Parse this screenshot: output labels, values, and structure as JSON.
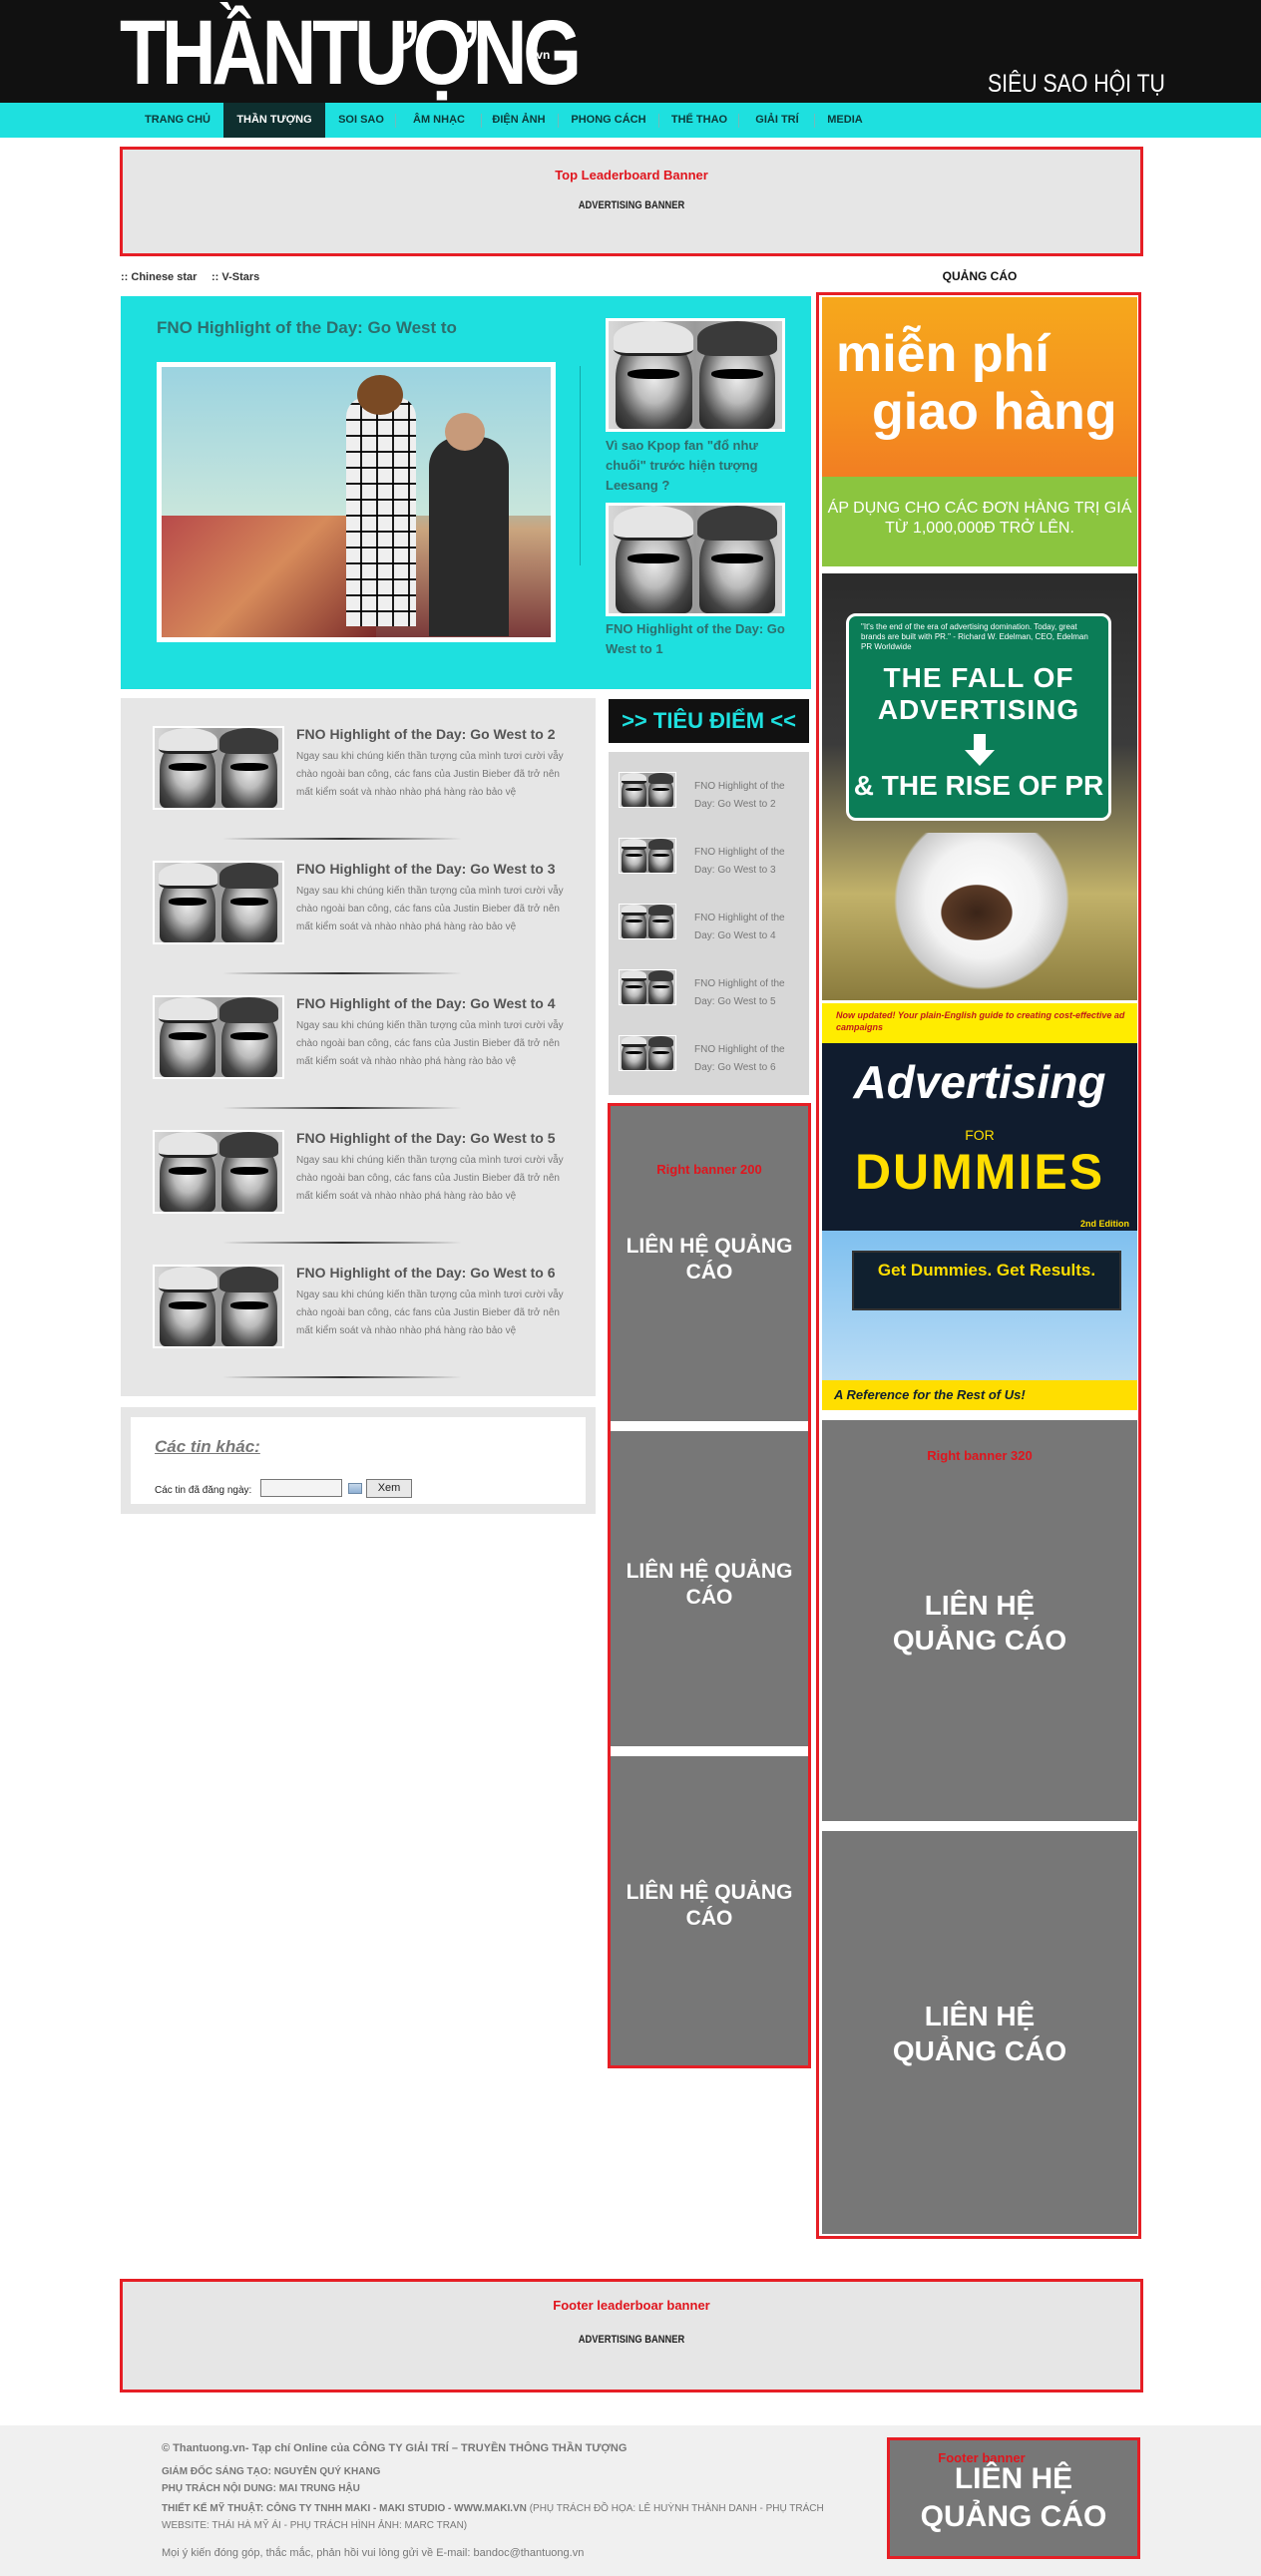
{
  "header": {
    "logo_text": "THẦNTƯỢNG",
    "logo_suffix": ".vn",
    "tagline": "SIÊU SAO HỘI TỤ"
  },
  "nav": [
    {
      "label": "TRANG CHỦ",
      "active": false
    },
    {
      "label": "THẦN TƯỢNG",
      "active": true
    },
    {
      "label": "SOI SAO",
      "active": false
    },
    {
      "label": "ÂM NHẠC",
      "active": false
    },
    {
      "label": "ĐIỆN ẢNH",
      "active": false
    },
    {
      "label": "PHONG CÁCH",
      "active": false
    },
    {
      "label": "THỂ THAO",
      "active": false
    },
    {
      "label": "GIẢI TRÍ",
      "active": false
    },
    {
      "label": "MEDIA",
      "active": false
    }
  ],
  "top_banner": {
    "title": "Top Leaderboard Banner",
    "sub": "ADVERTISING BANNER"
  },
  "breadcrumb": [
    ":: Chinese star",
    ":: V-Stars"
  ],
  "featured": {
    "title": "FNO Highlight of the Day: Go West to",
    "side": [
      "Vì sao Kpop fan \"đổ như chuối\" trước hiện tượng Leesang ?",
      "FNO Highlight of the Day: Go West to 1"
    ]
  },
  "news": [
    {
      "title": "FNO Highlight of the Day: Go West to 2",
      "desc": "Ngay sau khi chúng kiến thần tượng của mình tươi cười vẫy chào ngoài ban công, các fans của Justin Bieber đã trở nên mất kiểm soát và nhào nhào phá hàng rào bảo vệ"
    },
    {
      "title": "FNO Highlight of the Day: Go West to 3",
      "desc": "Ngay sau khi chúng kiến thần tượng của mình tươi cười vẫy chào ngoài ban công, các fans của Justin Bieber đã trở nên mất kiểm soát và nhào nhào phá hàng rào bảo vệ"
    },
    {
      "title": "FNO Highlight of the Day: Go West to 4",
      "desc": "Ngay sau khi chúng kiến thần tượng của mình tươi cười vẫy chào ngoài ban công, các fans của Justin Bieber đã trở nên mất kiểm soát và nhào nhào phá hàng rào bảo vệ"
    },
    {
      "title": "FNO Highlight of the Day: Go West to 5",
      "desc": "Ngay sau khi chúng kiến thần tượng của mình tươi cười vẫy chào ngoài ban công, các fans của Justin Bieber đã trở nên mất kiểm soát và nhào nhào phá hàng rào bảo vệ"
    },
    {
      "title": "FNO Highlight of the Day: Go West to 6",
      "desc": "Ngay sau khi chúng kiến thần tượng của mình tươi cười vẫy chào ngoài ban công, các fans của Justin Bieber đã trở nên mất kiểm soát và nhào nhào phá hàng rào bảo vệ"
    }
  ],
  "other_news": {
    "title": "Các tin khác:",
    "label": "Các tin đã đăng ngày:",
    "date_value": "",
    "button": "Xem"
  },
  "tieudiem": {
    "heading": ">> TIÊU ĐIỂM <<",
    "items": [
      "FNO Highlight of the Day: Go West to 2",
      "FNO Highlight of the Day: Go West to 3",
      "FNO Highlight of the Day: Go West to 4",
      "FNO Highlight of the Day: Go West to 5",
      "FNO Highlight of the Day: Go West to 6"
    ]
  },
  "right200": {
    "label": "Right banner 200",
    "contact": [
      "LIÊN HỆ QUẢNG CÁO",
      "LIÊN HỆ QUẢNG CÁO",
      "LIÊN HỆ QUẢNG CÁO"
    ]
  },
  "ads": {
    "label": "QUẢNG CÁO",
    "promo1_line1": "miễn phí",
    "promo1_line2": "giao hàng",
    "promo1_sub": "ÁP DỤNG CHO CÁC ĐƠN HÀNG TRỊ GIÁ TỪ 1,000,000Đ TRỞ LÊN.",
    "promo2_quote": "\"It's the end of the era of advertising domination. Today, great brands are built with PR.\" - Richard W. Edelman, CEO, Edelman PR Worldwide",
    "promo2_l1": "THE FALL OF ADVERTISING",
    "promo2_l2": "& THE RISE OF PR",
    "promo3_top": "Now updated! Your plain-English guide to creating cost-effective ad campaigns",
    "promo3_title": "Advertising",
    "promo3_for": "FOR",
    "promo3_dummies": "DUMMIES",
    "promo3_ed": "2nd Edition",
    "promo3_board": "Get Dummies. Get Results.",
    "promo3_bottom": "A Reference for the Rest of Us!"
  },
  "right320": {
    "label": "Right banner 320",
    "contact": [
      "LIÊN HỆ QUẢNG CÁO",
      "LIÊN HỆ QUẢNG CÁO"
    ]
  },
  "footer_banner": {
    "title": "Footer leaderboar banner",
    "sub": "ADVERTISING BANNER"
  },
  "footer": {
    "copyright": "© Thantuong.vn- Tạp chí Online của CÔNG TY GIẢI TRÍ – TRUYỀN THÔNG THẦN TƯỢNG",
    "director": "GIÁM ĐỐC SÁNG TẠO: NGUYỄN QUÝ KHANG",
    "content": "PHỤ TRÁCH NỘI DUNG: MAI TRUNG HẬU",
    "design": "THIẾT KẾ MỸ THUẬT: CÔNG TY TNHH MAKI - MAKI STUDIO - WWW.MAKI.VN",
    "design_extra": "(PHỤ TRÁCH ĐỒ HỌA: LÊ HUỲNH THÀNH DANH - PHỤ TRÁCH WEBSITE: THÁI HÀ MỸ ÁI - PHỤ TRÁCH HÌNH ẢNH: MARC TRAN)",
    "contact": "Mọi ý kiến đóng góp, thắc mắc, phản hồi vui lòng gửi về E-mail: bandoc@thantuong.vn",
    "footer_ad_label": "Footer banner",
    "footer_ad_text": "LIÊN HỆ QUẢNG CÁO"
  }
}
